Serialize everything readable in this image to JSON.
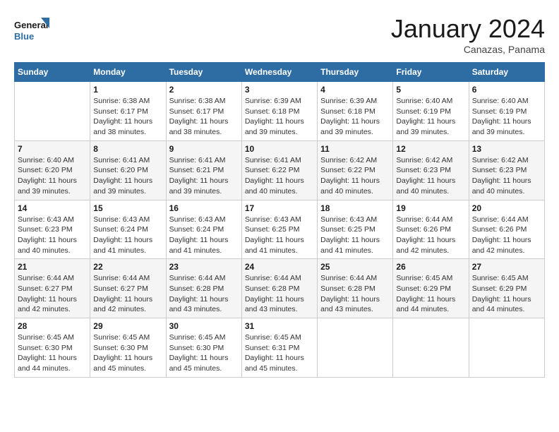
{
  "header": {
    "logo_general": "General",
    "logo_blue": "Blue",
    "month_title": "January 2024",
    "subtitle": "Canazas, Panama"
  },
  "weekdays": [
    "Sunday",
    "Monday",
    "Tuesday",
    "Wednesday",
    "Thursday",
    "Friday",
    "Saturday"
  ],
  "weeks": [
    [
      {
        "day": "",
        "info": ""
      },
      {
        "day": "1",
        "info": "Sunrise: 6:38 AM\nSunset: 6:17 PM\nDaylight: 11 hours and 38 minutes."
      },
      {
        "day": "2",
        "info": "Sunrise: 6:38 AM\nSunset: 6:17 PM\nDaylight: 11 hours and 38 minutes."
      },
      {
        "day": "3",
        "info": "Sunrise: 6:39 AM\nSunset: 6:18 PM\nDaylight: 11 hours and 39 minutes."
      },
      {
        "day": "4",
        "info": "Sunrise: 6:39 AM\nSunset: 6:18 PM\nDaylight: 11 hours and 39 minutes."
      },
      {
        "day": "5",
        "info": "Sunrise: 6:40 AM\nSunset: 6:19 PM\nDaylight: 11 hours and 39 minutes."
      },
      {
        "day": "6",
        "info": "Sunrise: 6:40 AM\nSunset: 6:19 PM\nDaylight: 11 hours and 39 minutes."
      }
    ],
    [
      {
        "day": "7",
        "info": "Sunrise: 6:40 AM\nSunset: 6:20 PM\nDaylight: 11 hours and 39 minutes."
      },
      {
        "day": "8",
        "info": "Sunrise: 6:41 AM\nSunset: 6:20 PM\nDaylight: 11 hours and 39 minutes."
      },
      {
        "day": "9",
        "info": "Sunrise: 6:41 AM\nSunset: 6:21 PM\nDaylight: 11 hours and 39 minutes."
      },
      {
        "day": "10",
        "info": "Sunrise: 6:41 AM\nSunset: 6:22 PM\nDaylight: 11 hours and 40 minutes."
      },
      {
        "day": "11",
        "info": "Sunrise: 6:42 AM\nSunset: 6:22 PM\nDaylight: 11 hours and 40 minutes."
      },
      {
        "day": "12",
        "info": "Sunrise: 6:42 AM\nSunset: 6:23 PM\nDaylight: 11 hours and 40 minutes."
      },
      {
        "day": "13",
        "info": "Sunrise: 6:42 AM\nSunset: 6:23 PM\nDaylight: 11 hours and 40 minutes."
      }
    ],
    [
      {
        "day": "14",
        "info": "Sunrise: 6:43 AM\nSunset: 6:23 PM\nDaylight: 11 hours and 40 minutes."
      },
      {
        "day": "15",
        "info": "Sunrise: 6:43 AM\nSunset: 6:24 PM\nDaylight: 11 hours and 41 minutes."
      },
      {
        "day": "16",
        "info": "Sunrise: 6:43 AM\nSunset: 6:24 PM\nDaylight: 11 hours and 41 minutes."
      },
      {
        "day": "17",
        "info": "Sunrise: 6:43 AM\nSunset: 6:25 PM\nDaylight: 11 hours and 41 minutes."
      },
      {
        "day": "18",
        "info": "Sunrise: 6:43 AM\nSunset: 6:25 PM\nDaylight: 11 hours and 41 minutes."
      },
      {
        "day": "19",
        "info": "Sunrise: 6:44 AM\nSunset: 6:26 PM\nDaylight: 11 hours and 42 minutes."
      },
      {
        "day": "20",
        "info": "Sunrise: 6:44 AM\nSunset: 6:26 PM\nDaylight: 11 hours and 42 minutes."
      }
    ],
    [
      {
        "day": "21",
        "info": "Sunrise: 6:44 AM\nSunset: 6:27 PM\nDaylight: 11 hours and 42 minutes."
      },
      {
        "day": "22",
        "info": "Sunrise: 6:44 AM\nSunset: 6:27 PM\nDaylight: 11 hours and 42 minutes."
      },
      {
        "day": "23",
        "info": "Sunrise: 6:44 AM\nSunset: 6:28 PM\nDaylight: 11 hours and 43 minutes."
      },
      {
        "day": "24",
        "info": "Sunrise: 6:44 AM\nSunset: 6:28 PM\nDaylight: 11 hours and 43 minutes."
      },
      {
        "day": "25",
        "info": "Sunrise: 6:44 AM\nSunset: 6:28 PM\nDaylight: 11 hours and 43 minutes."
      },
      {
        "day": "26",
        "info": "Sunrise: 6:45 AM\nSunset: 6:29 PM\nDaylight: 11 hours and 44 minutes."
      },
      {
        "day": "27",
        "info": "Sunrise: 6:45 AM\nSunset: 6:29 PM\nDaylight: 11 hours and 44 minutes."
      }
    ],
    [
      {
        "day": "28",
        "info": "Sunrise: 6:45 AM\nSunset: 6:30 PM\nDaylight: 11 hours and 44 minutes."
      },
      {
        "day": "29",
        "info": "Sunrise: 6:45 AM\nSunset: 6:30 PM\nDaylight: 11 hours and 45 minutes."
      },
      {
        "day": "30",
        "info": "Sunrise: 6:45 AM\nSunset: 6:30 PM\nDaylight: 11 hours and 45 minutes."
      },
      {
        "day": "31",
        "info": "Sunrise: 6:45 AM\nSunset: 6:31 PM\nDaylight: 11 hours and 45 minutes."
      },
      {
        "day": "",
        "info": ""
      },
      {
        "day": "",
        "info": ""
      },
      {
        "day": "",
        "info": ""
      }
    ]
  ]
}
